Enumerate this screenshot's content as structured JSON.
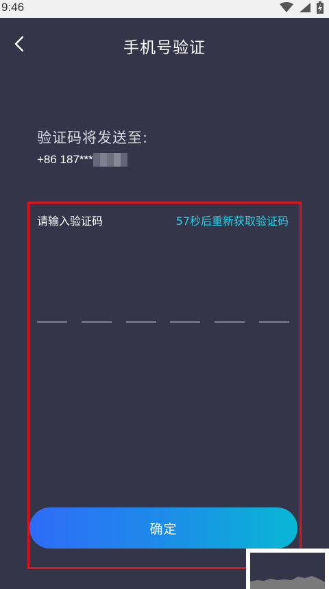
{
  "status_bar": {
    "time": "9:46",
    "icons": [
      "wifi-icon",
      "signal-icon",
      "battery-charging-icon"
    ]
  },
  "header": {
    "title": "手机号验证",
    "back_icon": "chevron-left-icon"
  },
  "verification": {
    "send_label": "验证码将发送至:",
    "phone_number": "+86 187***",
    "code_label": "请输入验证码",
    "resend_text": "57秒后重新获取验证码",
    "code_length": 6
  },
  "actions": {
    "confirm_label": "确定"
  },
  "colors": {
    "background": "#343549",
    "accent_cyan": "#29d3e8",
    "highlight_red": "#e0141e",
    "button_gradient_start": "#2f6bf8",
    "button_gradient_end": "#08b7d4"
  }
}
